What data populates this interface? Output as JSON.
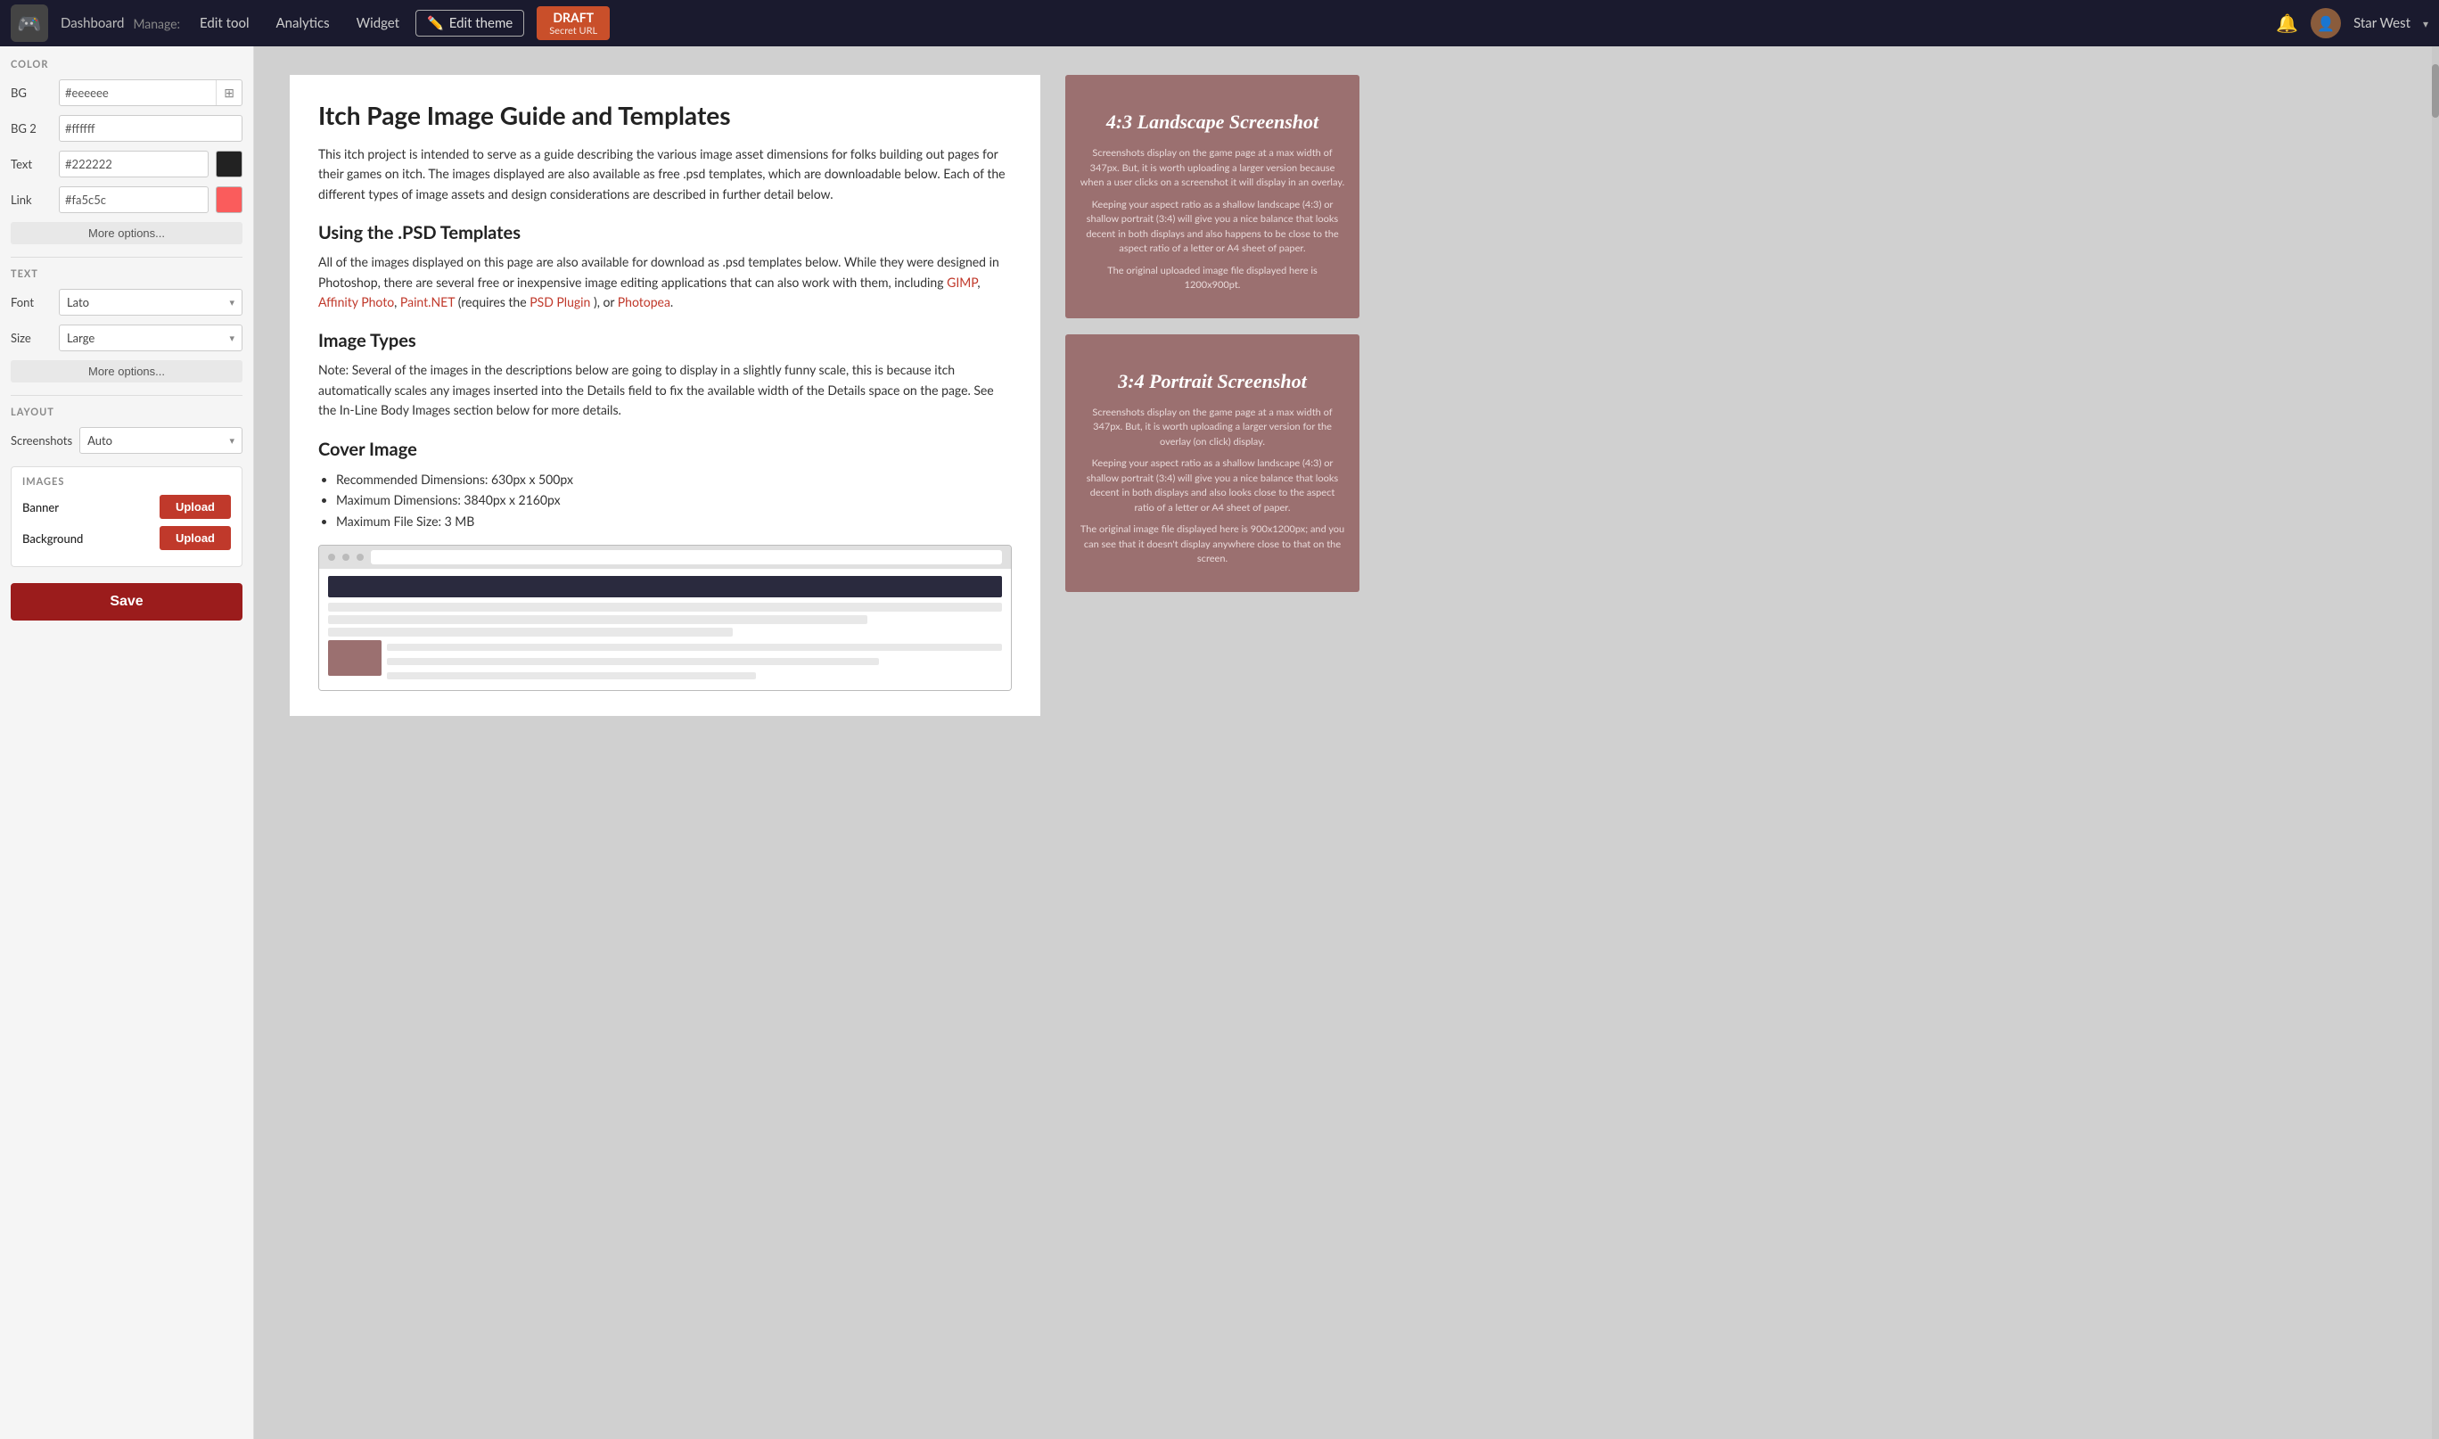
{
  "topnav": {
    "logo": "🎮",
    "dashboard": "Dashboard",
    "manage_label": "Manage:",
    "items": [
      {
        "label": "Edit tool",
        "id": "edit-tool"
      },
      {
        "label": "Analytics",
        "id": "analytics"
      },
      {
        "label": "Widget",
        "id": "widget"
      }
    ],
    "edit_theme_label": "Edit theme",
    "edit_theme_icon": "✏️",
    "draft_label": "DRAFT",
    "draft_sub": "Secret URL",
    "bell_icon": "🔔",
    "username": "Star West",
    "chevron": "▾"
  },
  "left_panel": {
    "color_section": "COLOR",
    "fields": [
      {
        "label": "BG",
        "value": "#eeeeee",
        "swatch": "#eeeeee",
        "has_icon": true
      },
      {
        "label": "BG 2",
        "value": "#ffffff",
        "swatch": "#ffffff",
        "has_icon": false
      },
      {
        "label": "Text",
        "value": "#222222",
        "swatch": "#222222",
        "has_icon": false
      },
      {
        "label": "Link",
        "value": "#fa5c5c",
        "swatch": "#fa5c5c",
        "has_icon": false
      }
    ],
    "more_options_1": "More options...",
    "text_section": "TEXT",
    "font_label": "Font",
    "font_value": "Lato",
    "size_label": "Size",
    "size_value": "Large",
    "more_options_2": "More options...",
    "layout_section": "LAYOUT",
    "screenshots_label": "Screenshots",
    "screenshots_value": "Auto",
    "images_section": "IMAGES",
    "banner_label": "Banner",
    "banner_upload": "Upload",
    "background_label": "Background",
    "background_upload": "Upload",
    "save_label": "Save"
  },
  "main": {
    "title": "Itch Page Image Guide and Templates",
    "intro": "This itch project is intended to serve as a guide describing the various image asset dimensions for folks building out pages for their games on itch. The images displayed are also available as free .psd templates, which are downloadable below. Each of the different types of image assets and design considerations are described in further detail below.",
    "section1_title": "Using the .PSD Templates",
    "section1_body": "All of the images displayed on this page are also available for download as .psd templates below. While they were designed in Photoshop, there are several free or inexpensive image editing applications that can also work with them, including",
    "links": [
      "GIMP",
      "Affinity Photo",
      "Paint.NET"
    ],
    "section1_cont": "(requires the",
    "psd_link": "PSD Plugin",
    "section1_end": "), or",
    "photopea_link": "Photopea",
    "section1_period": ".",
    "section2_title": "Image Types",
    "section2_body": "Note: Several of the images in the descriptions below are going to display in a slightly funny scale, this is because itch automatically scales any images inserted into the Details field to fix the available width of the Details space on the page. See the In-Line Body Images section below for more details.",
    "section3_title": "Cover Image",
    "cover_bullets": [
      "Recommended Dimensions: 630px x 500px",
      "Maximum Dimensions: 3840px x 2160px",
      "Maximum File Size: 3 MB"
    ],
    "card1_title": "4:3 Landscape Screenshot",
    "card1_p1": "Screenshots display on the game page at a max width of 347px. But, it is worth uploading a larger version because when a user clicks on a screenshot it will display in an overlay.",
    "card1_p2": "Keeping your aspect ratio as a shallow landscape (4:3) or shallow portrait (3:4) will give you a nice balance that looks decent in both displays and also happens to be close to the aspect ratio of a letter or A4 sheet of paper.",
    "card1_p3": "The original uploaded image file displayed here is 1200x900pt.",
    "card2_title": "3:4 Portrait Screenshot",
    "card2_p1": "Screenshots display on the game page at a max width of 347px. But, it is worth uploading a larger version for the overlay (on click) display.",
    "card2_p2": "Keeping your aspect ratio as a shallow landscape (4:3) or shallow portrait (3:4) will give you a nice balance that looks decent in both displays and also looks close to the aspect ratio of a letter or A4 sheet of paper.",
    "card2_p3": "The original image file displayed here is 900x1200px; and you can see that it doesn't display anywhere close to that on the screen."
  }
}
